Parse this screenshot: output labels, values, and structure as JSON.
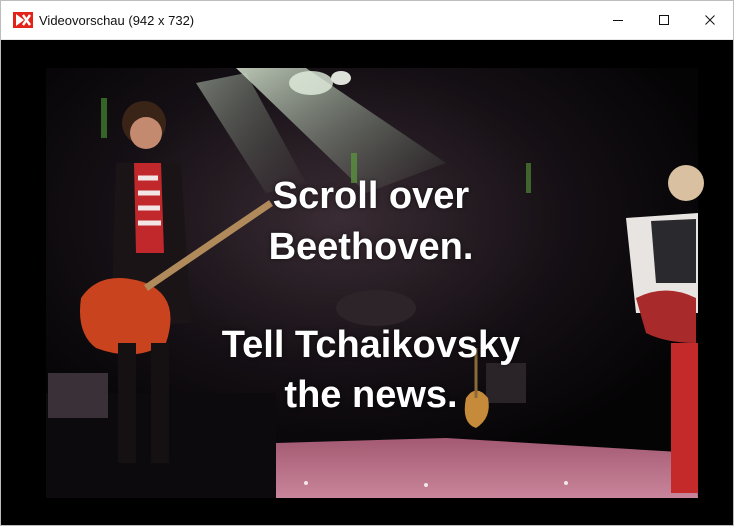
{
  "window": {
    "title": "Videovorschau (942 x 732)",
    "app_icon": "app-logo-icon",
    "controls": [
      "minimize-icon",
      "maximize-icon",
      "close-icon"
    ],
    "accent_color": "#e2231a"
  },
  "video": {
    "subtitle_lines": [
      "Scroll over",
      "Beethoven.",
      "Tell Tchaikovsky",
      "the news."
    ],
    "subtitle_color": "#ffffff"
  }
}
